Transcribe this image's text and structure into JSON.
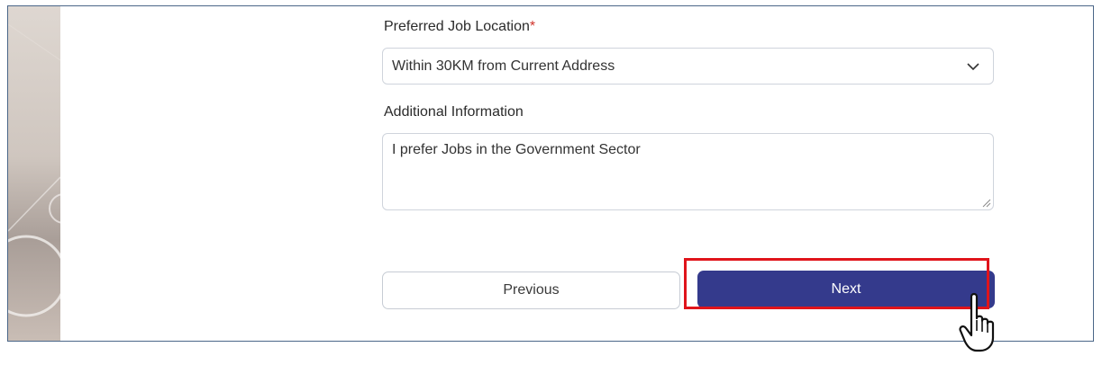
{
  "form": {
    "location_label": "Preferred Job Location",
    "required_mark": "*",
    "location_value": "Within 30KM from Current Address",
    "additional_label": "Additional Information",
    "additional_value": "I prefer Jobs in the Government Sector"
  },
  "buttons": {
    "previous": "Previous",
    "next": "Next"
  },
  "colors": {
    "primary": "#343a8c",
    "highlight": "#e0141b",
    "required": "#d0342c"
  },
  "icons": {
    "dropdown": "chevron-down-icon",
    "resize": "resize-handle-icon",
    "cursor": "hand-pointer-icon"
  }
}
